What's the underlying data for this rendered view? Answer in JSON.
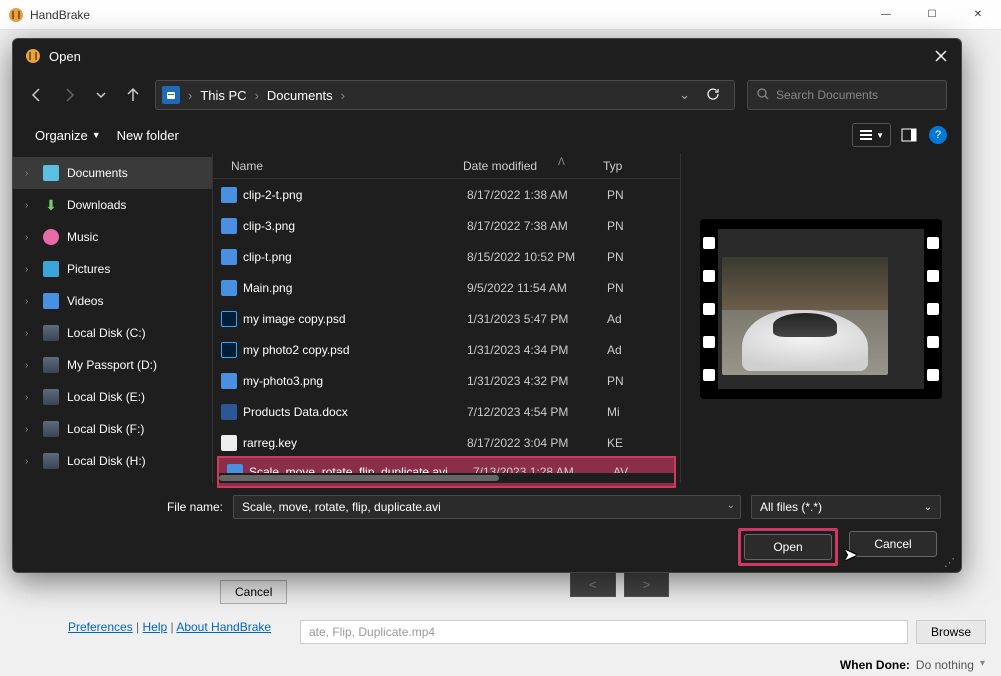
{
  "hb": {
    "title": "HandBrake",
    "cancel": "Cancel",
    "preferences": "Preferences",
    "help": "Help",
    "about": "About HandBrake",
    "output_partial": "ate, Flip, Duplicate.mp4",
    "browse": "Browse",
    "when_done_label": "When Done:",
    "when_done_value": "Do nothing",
    "prev": "<",
    "next": ">"
  },
  "dialog": {
    "title": "Open",
    "breadcrumb": [
      "This PC",
      "Documents"
    ],
    "search_placeholder": "Search Documents",
    "organize": "Organize",
    "new_folder": "New folder",
    "columns": {
      "name": "Name",
      "date": "Date modified",
      "type": "Typ"
    },
    "sidebar": [
      {
        "label": "Documents",
        "icon": "docs",
        "arrow": ">",
        "active": true
      },
      {
        "label": "Downloads",
        "icon": "downloads",
        "arrow": ">"
      },
      {
        "label": "Music",
        "icon": "music",
        "arrow": ">"
      },
      {
        "label": "Pictures",
        "icon": "pictures",
        "arrow": ">"
      },
      {
        "label": "Videos",
        "icon": "videos",
        "arrow": ">"
      },
      {
        "label": "Local Disk (C:)",
        "icon": "disk",
        "arrow": ">"
      },
      {
        "label": "My Passport (D:)",
        "icon": "disk",
        "arrow": ">"
      },
      {
        "label": "Local Disk (E:)",
        "icon": "disk",
        "arrow": ">"
      },
      {
        "label": "Local Disk (F:)",
        "icon": "disk",
        "arrow": ">"
      },
      {
        "label": "Local Disk (H:)",
        "icon": "disk",
        "arrow": ">"
      }
    ],
    "files": [
      {
        "name": "clip-2-t.png",
        "date": "8/17/2022 1:38 AM",
        "type": "PN",
        "icon": "png"
      },
      {
        "name": "clip-3.png",
        "date": "8/17/2022 7:38 AM",
        "type": "PN",
        "icon": "png"
      },
      {
        "name": "clip-t.png",
        "date": "8/15/2022 10:52 PM",
        "type": "PN",
        "icon": "png"
      },
      {
        "name": "Main.png",
        "date": "9/5/2022 11:54 AM",
        "type": "PN",
        "icon": "png"
      },
      {
        "name": "my image copy.psd",
        "date": "1/31/2023 5:47 PM",
        "type": "Ad",
        "icon": "psd"
      },
      {
        "name": "my photo2 copy.psd",
        "date": "1/31/2023 4:34 PM",
        "type": "Ad",
        "icon": "psd"
      },
      {
        "name": "my-photo3.png",
        "date": "1/31/2023 4:32 PM",
        "type": "PN",
        "icon": "png"
      },
      {
        "name": "Products Data.docx",
        "date": "7/12/2023 4:54 PM",
        "type": "Mi",
        "icon": "docx"
      },
      {
        "name": "rarreg.key",
        "date": "8/17/2022 3:04 PM",
        "type": "KE",
        "icon": "key"
      },
      {
        "name": "Scale, move, rotate, flip, duplicate.avi",
        "date": "7/13/2023 1:28 AM",
        "type": "AV",
        "icon": "avi",
        "selected": true
      }
    ],
    "filename_label": "File name:",
    "filename_value": "Scale, move, rotate, flip, duplicate.avi",
    "filter": "All files (*.*)",
    "open_btn": "Open",
    "cancel_btn": "Cancel"
  }
}
